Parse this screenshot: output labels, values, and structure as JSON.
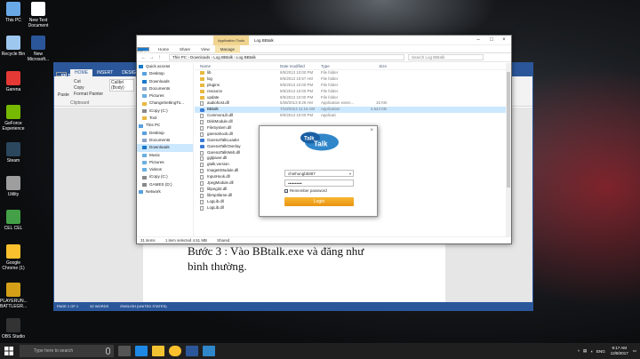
{
  "desktop": {
    "icons": [
      {
        "label": "This PC",
        "color": "#6aa9e8"
      },
      {
        "label": "New Text Document",
        "color": "#ffffff"
      },
      {
        "label": "Recycle Bin",
        "color": "#9ec7f0"
      },
      {
        "label": "New Microsoft...",
        "color": "#2b579a"
      },
      {
        "label": "Garena",
        "color": "#e53935"
      },
      {
        "label": "GeForce Experience",
        "color": "#76b900"
      },
      {
        "label": "Steam",
        "color": "#2a475e"
      },
      {
        "label": "Utility",
        "color": "#9e9e9e"
      },
      {
        "label": "CEL CEL",
        "color": "#43a047"
      },
      {
        "label": "Google Chrome (1)",
        "color": "#fbc02d"
      },
      {
        "label": "PLAYERUN... BATTLEGR...",
        "color": "#d4a017"
      },
      {
        "label": "OBS Studio",
        "color": "#333333"
      }
    ]
  },
  "word": {
    "tabs": [
      "FILE",
      "HOME",
      "INSERT",
      "DESIGN"
    ],
    "ribbon": {
      "paste": "Paste",
      "cut": "Cut",
      "copy": "Copy",
      "format_painter": "Format Painter",
      "clipboard": "Clipboard",
      "font": "Calibri (Body)"
    },
    "body_line1": "Bước 3 : Vào BBtalk.exe và đăng như",
    "body_line2": "bình thường.",
    "status": [
      "PAGE 1 OF 1",
      "52 WORDS",
      "ENGLISH (UNITED STATES)"
    ]
  },
  "explorer": {
    "app_tools": "Application Tools",
    "title": "Log BBtalk",
    "tabs": [
      "File",
      "Home",
      "Share",
      "View",
      "Manage"
    ],
    "path": "This PC  ›  Downloads  ›  Log BBtalk  ›  Log BBtalk",
    "search_placeholder": "Search Log BBtalk",
    "columns": {
      "name": "Name",
      "date": "Date modified",
      "type": "Type",
      "size": "Size"
    },
    "nav": [
      {
        "label": "Quick access",
        "icon": "star"
      },
      {
        "label": "Desktop",
        "icon": "folder-blue"
      },
      {
        "label": "Downloads",
        "icon": "download"
      },
      {
        "label": "Documents",
        "icon": "doc"
      },
      {
        "label": "Pictures",
        "icon": "picture"
      },
      {
        "label": "ChangeSettingTo...",
        "icon": "folder"
      },
      {
        "label": "iCopy (C:)",
        "icon": "drive"
      },
      {
        "label": "Tool",
        "icon": "folder"
      },
      {
        "label": "This PC",
        "icon": "pc"
      },
      {
        "label": "Desktop",
        "icon": "folder-blue"
      },
      {
        "label": "Documents",
        "icon": "doc"
      },
      {
        "label": "Downloads",
        "icon": "download"
      },
      {
        "label": "Music",
        "icon": "music"
      },
      {
        "label": "Pictures",
        "icon": "picture"
      },
      {
        "label": "Videos",
        "icon": "video"
      },
      {
        "label": "iCopy (C:)",
        "icon": "drive"
      },
      {
        "label": "GAMES (D:)",
        "icon": "drive"
      },
      {
        "label": "Network",
        "icon": "network"
      }
    ],
    "files": [
      {
        "name": "lib",
        "date": "9/5/2013 10:00 PM",
        "type": "File folder",
        "size": "",
        "kind": "folder"
      },
      {
        "name": "log",
        "date": "9/6/2013 10:57 AM",
        "type": "File folder",
        "size": "",
        "kind": "folder"
      },
      {
        "name": "plugins",
        "date": "9/5/2013 10:00 PM",
        "type": "File folder",
        "size": "",
        "kind": "folder"
      },
      {
        "name": "resource",
        "date": "9/5/2013 10:00 PM",
        "type": "File folder",
        "size": "",
        "kind": "folder"
      },
      {
        "name": "update",
        "date": "9/5/2013 10:00 PM",
        "type": "File folder",
        "size": "",
        "kind": "folder"
      },
      {
        "name": "audiohost.dll",
        "date": "5/28/2013 8:29 AM",
        "type": "Application exten...",
        "size": "15 KB",
        "kind": "file"
      },
      {
        "name": "BBtalk",
        "date": "7/10/2013 11:16 AM",
        "type": "Application",
        "size": "4,624 KB",
        "kind": "exe"
      },
      {
        "name": "CommonLib.dll",
        "date": "9/5/2013 10:00 PM",
        "type": "Applicati",
        "size": "",
        "kind": "file"
      },
      {
        "name": "DiskModule.dll",
        "date": "",
        "type": "",
        "size": "",
        "kind": "file"
      },
      {
        "name": "FileSystem.dll",
        "date": "",
        "type": "",
        "size": "",
        "kind": "file"
      },
      {
        "name": "garenahook.dll",
        "date": "",
        "type": "",
        "size": "",
        "kind": "file"
      },
      {
        "name": "GarenaTalkLoader",
        "date": "",
        "type": "",
        "size": "",
        "kind": "exe"
      },
      {
        "name": "GarenaTalkOverlay",
        "date": "",
        "type": "",
        "size": "",
        "kind": "exe"
      },
      {
        "name": "GarenaTalkWeb.dll",
        "date": "",
        "type": "",
        "size": "",
        "kind": "file"
      },
      {
        "name": "gglpaver.dll",
        "date": "",
        "type": "",
        "size": "",
        "kind": "file"
      },
      {
        "name": "gtalk.version",
        "date": "",
        "type": "",
        "size": "",
        "kind": "file"
      },
      {
        "name": "ImageKModule.dll",
        "date": "",
        "type": "",
        "size": "",
        "kind": "file"
      },
      {
        "name": "InputHook.dll",
        "date": "",
        "type": "",
        "size": "",
        "kind": "file"
      },
      {
        "name": "JpegModule.dll",
        "date": "",
        "type": "",
        "size": "",
        "kind": "file"
      },
      {
        "name": "libpng32.dll",
        "date": "",
        "type": "",
        "size": "",
        "kind": "file"
      },
      {
        "name": "libmp3lame.dll",
        "date": "",
        "type": "",
        "size": "",
        "kind": "file"
      },
      {
        "name": "LogLib.dll",
        "date": "9/5/2013 11:34 AM",
        "type": "Application exten...",
        "size": "",
        "kind": "file"
      },
      {
        "name": "LogLib.dll",
        "date": "9/5/2013 11:34 AM",
        "type": "Application exten...",
        "size": "",
        "kind": "file"
      }
    ],
    "status": [
      "31 items",
      "1 item selected  4.51 MB",
      "Shared"
    ]
  },
  "login": {
    "username": "chiehungbb887",
    "password": "••••••••••",
    "remember": "Remember password",
    "button": "Login",
    "logo_top": "Talk",
    "logo_bottom": "Talk",
    "close": "×"
  },
  "taskbar": {
    "search_placeholder": "Type here to search",
    "time": "9:17 AM",
    "date": "12/8/2017",
    "lang": "ENG"
  }
}
